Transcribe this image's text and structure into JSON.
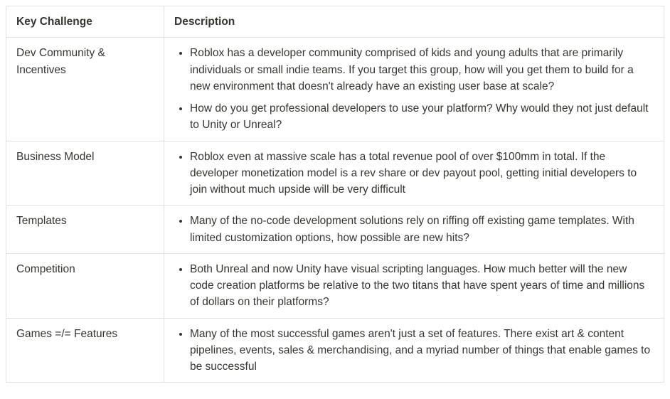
{
  "chart_data": {
    "type": "table",
    "title": "",
    "headers": [
      "Key Challenge",
      "Description"
    ],
    "rows": [
      {
        "challenge": "Dev Community & Incentives",
        "bullets": [
          "Roblox has a developer community comprised of kids and young adults that are primarily individuals or small indie teams. If you target this group, how will you get them to build for a new environment that doesn't already have an existing user base at scale?",
          "How do you get professional developers to use your platform? Why would they not just default to Unity or Unreal?"
        ]
      },
      {
        "challenge": "Business Model",
        "bullets": [
          "Roblox even at massive scale has a total revenue pool of over $100mm in total. If the developer monetization model is a rev share or dev payout pool, getting initial developers to join without much upside will be very difficult"
        ]
      },
      {
        "challenge": "Templates",
        "bullets": [
          "Many of the no-code development solutions rely on riffing off existing game templates. With limited customization options, how possible are new hits?"
        ]
      },
      {
        "challenge": "Competition",
        "bullets": [
          "Both Unreal and now Unity have visual scripting languages. How much better will the new code creation platforms be relative to the two titans that have spent years of time and millions of dollars on their platforms?"
        ]
      },
      {
        "challenge": "Games =/= Features",
        "bullets": [
          "Many of the most successful games aren't just a set of features. There exist art & content pipelines, events, sales & merchandising, and a myriad number of things that enable games to be successful"
        ]
      }
    ]
  }
}
